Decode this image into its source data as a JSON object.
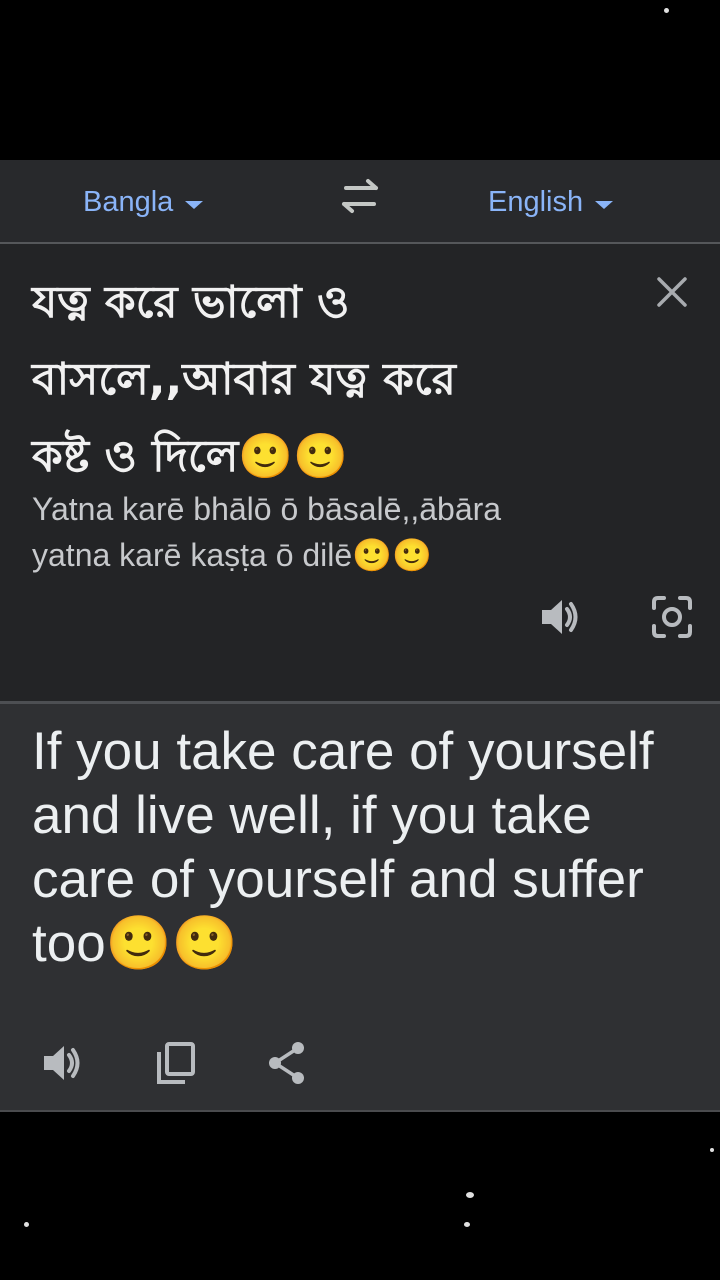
{
  "languages": {
    "source": "Bangla",
    "target": "English"
  },
  "source": {
    "text": "যত্ন করে ভালো ও\nবাসলে,,আবার যত্ন করে\nকষ্ট ও দিলে🙂🙂",
    "transliteration": "Yatna karē bhālō ō bāsalē,,ābāra\nyatna karē kaṣṭa ō dilē🙂🙂"
  },
  "translation": {
    "text": "If you take care of yourself\nand live well, if you take\ncare of yourself and suffer\ntoo🙂🙂"
  },
  "icons": {
    "caret": "caret-down-icon",
    "swap": "swap-arrows-icon",
    "close": "close-icon",
    "speaker": "speaker-icon",
    "camera": "camera-icon",
    "copy": "copy-icon",
    "share": "share-icon"
  },
  "colors": {
    "accent": "#8ab4f8",
    "panel": "#27282b",
    "source_bg": "#232426",
    "target_bg": "#2f3033",
    "icon": "#9aa0a6"
  }
}
